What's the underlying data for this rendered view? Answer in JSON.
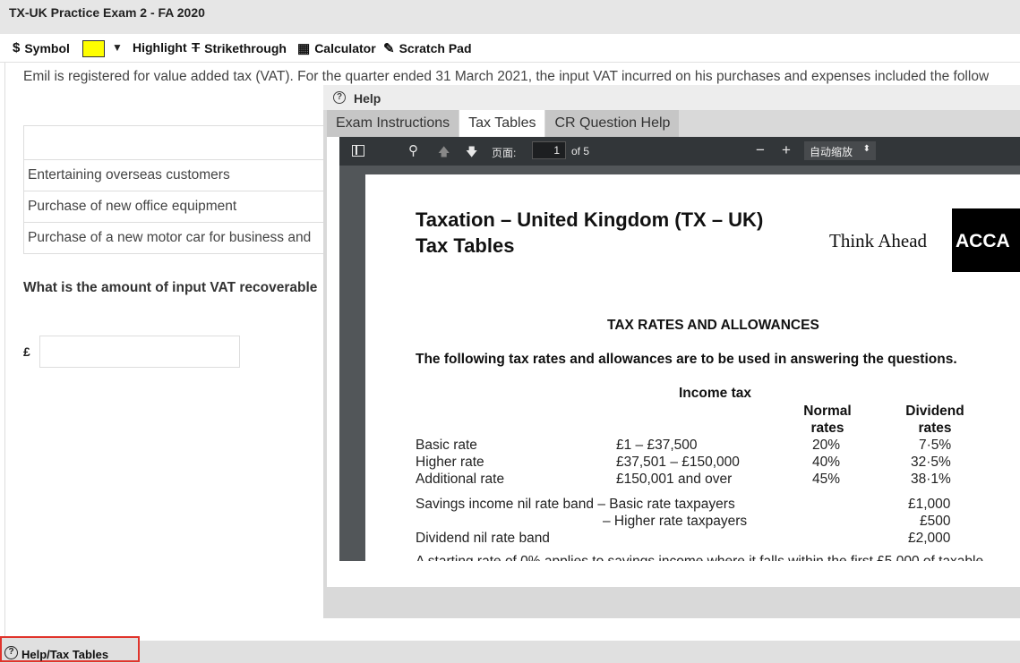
{
  "window": {
    "title": "TX-UK Practice Exam 2 - FA 2020"
  },
  "toolbar": {
    "symbol": {
      "icon": "dollar-icon",
      "glyph": "$",
      "label": "Symbol"
    },
    "highlight": {
      "color": "#ffff00",
      "dropdown_glyph": "▼",
      "label": "Highlight"
    },
    "strikethrough": {
      "icon": "strikethrough-icon",
      "glyph": "T",
      "label": "Strikethrough"
    },
    "calculator": {
      "icon": "calculator-icon",
      "glyph": "▦",
      "label": "Calculator"
    },
    "scratch_pad": {
      "icon": "pencil-icon",
      "glyph": "✎",
      "label": "Scratch Pad"
    }
  },
  "question": {
    "text": "Emil is registered for value added tax (VAT). For the quarter ended 31 March 2021, the input VAT incurred on his purchases and expenses included the follow",
    "table_rows": [
      "",
      "Entertaining overseas customers",
      "Purchase of new office equipment",
      "Purchase of a new motor car for business and"
    ],
    "prompt": "What is the amount of input VAT recoverable",
    "currency_symbol": "£",
    "answer_value": ""
  },
  "help_panel": {
    "title": "Help",
    "tabs": [
      {
        "label": "Exam Instructions",
        "active": false
      },
      {
        "label": "Tax Tables",
        "active": true
      },
      {
        "label": "CR Question Help",
        "active": false
      }
    ],
    "pdf_toolbar": {
      "page_label": "页面:",
      "current_page": "1",
      "of_pages": "of 5",
      "zoom_minus": "−",
      "zoom_plus": "+",
      "zoom_value": "自动缩放",
      "zoom_caret": "⬍"
    },
    "document": {
      "title_line1": "Taxation – United Kingdom (TX – UK)",
      "title_line2": "Tax Tables",
      "slogan": "Think Ahead",
      "logo": "ACCA",
      "section": "TAX RATES AND ALLOWANCES",
      "intro": "The following tax rates and allowances are to be used in answering the questions.",
      "income_tax_heading": "Income tax",
      "col_normal": [
        "Normal",
        "rates"
      ],
      "col_dividend": [
        "Dividend",
        "rates"
      ],
      "rate_rows": [
        {
          "band": "Basic rate",
          "range": "£1 – £37,500",
          "normal": "20%",
          "dividend": "7·5%"
        },
        {
          "band": "Higher rate",
          "range": "£37,501 – £150,000",
          "normal": "40%",
          "dividend": "32·5%"
        },
        {
          "band": "Additional rate",
          "range": "£150,001 and over",
          "normal": "45%",
          "dividend": "38·1%"
        }
      ],
      "savings_label": "Savings income nil rate band – Basic rate taxpayers",
      "savings_basic": "£1,000",
      "savings_higher_label": "– Higher rate taxpayers",
      "savings_higher": "£500",
      "dividend_nil_label": "Dividend nil rate band",
      "dividend_nil": "£2,000",
      "cut_line": "A starting rate of 0% applies to savings income where it falls within the first £5,000 of taxable"
    }
  },
  "footer": {
    "help_label": "Help/Tax Tables"
  }
}
